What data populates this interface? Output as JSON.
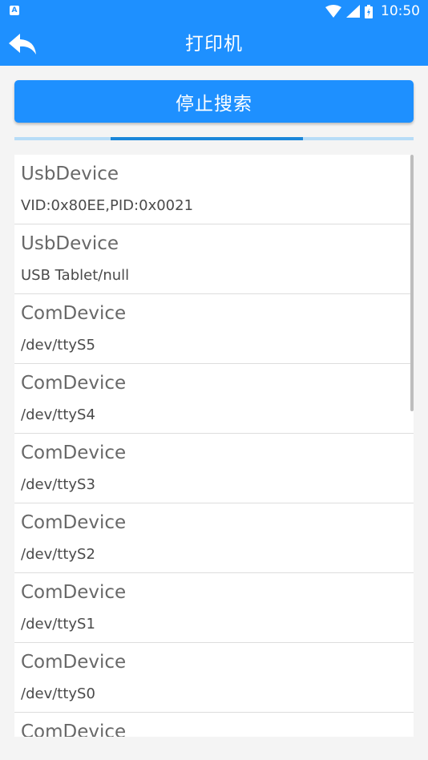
{
  "status_bar": {
    "app_icon_letter": "A",
    "time": "10:50",
    "icons": [
      "app-notification-icon",
      "wifi-icon",
      "signal-icon",
      "battery-icon"
    ]
  },
  "app_bar": {
    "title": "打印机",
    "back_icon": "back-arrow-icon"
  },
  "search_button": {
    "label": "停止搜索"
  },
  "colors": {
    "primary": "#1e90ff",
    "progress_track": "#b7dcf7",
    "progress_fill": "#1a86d9",
    "background": "#f4f4f4",
    "item_title": "#686868",
    "item_detail": "#4a4a4a"
  },
  "devices": [
    {
      "name": "UsbDevice",
      "detail": "VID:0x80EE,PID:0x0021"
    },
    {
      "name": "UsbDevice",
      "detail": "USB Tablet/null"
    },
    {
      "name": "ComDevice",
      "detail": "/dev/ttyS5"
    },
    {
      "name": "ComDevice",
      "detail": "/dev/ttyS4"
    },
    {
      "name": "ComDevice",
      "detail": "/dev/ttyS3"
    },
    {
      "name": "ComDevice",
      "detail": "/dev/ttyS2"
    },
    {
      "name": "ComDevice",
      "detail": "/dev/ttyS1"
    },
    {
      "name": "ComDevice",
      "detail": "/dev/ttyS0"
    },
    {
      "name": "ComDevice",
      "detail": ""
    }
  ]
}
